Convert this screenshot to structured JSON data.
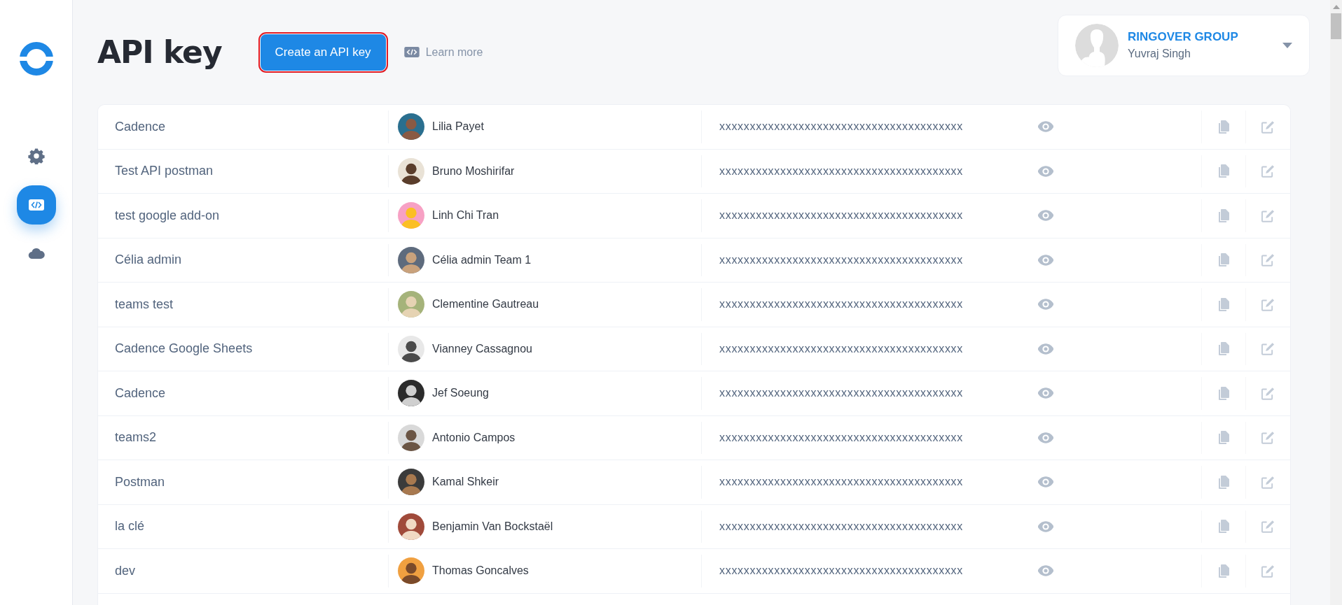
{
  "sidebar": {
    "items": [
      {
        "kind": "settings",
        "selected": false
      },
      {
        "kind": "code",
        "selected": true
      },
      {
        "kind": "cloud",
        "selected": false
      }
    ]
  },
  "header": {
    "title": "API key",
    "create_button": {
      "label": "Create an API key",
      "outlined": true
    },
    "learn_more": "Learn more"
  },
  "account": {
    "company": "RINGOVER GROUP",
    "user": "Yuvraj Singh"
  },
  "table": {
    "rows": [
      {
        "name": "Cadence",
        "owner": "Lilia Payet",
        "key": "xxxxxxxxxxxxxxxxxxxxxxxxxxxxxxxxxxxxxxxx"
      },
      {
        "name": "Test API postman",
        "owner": "Bruno Moshirifar",
        "key": "xxxxxxxxxxxxxxxxxxxxxxxxxxxxxxxxxxxxxxxx"
      },
      {
        "name": "test google add-on",
        "owner": "Linh Chi Tran",
        "key": "xxxxxxxxxxxxxxxxxxxxxxxxxxxxxxxxxxxxxxxx"
      },
      {
        "name": "Célia admin",
        "owner": "Célia admin Team 1",
        "key": "xxxxxxxxxxxxxxxxxxxxxxxxxxxxxxxxxxxxxxxx"
      },
      {
        "name": "teams test",
        "owner": "Clementine Gautreau",
        "key": "xxxxxxxxxxxxxxxxxxxxxxxxxxxxxxxxxxxxxxxx"
      },
      {
        "name": "Cadence Google Sheets",
        "owner": "Vianney Cassagnou",
        "key": "xxxxxxxxxxxxxxxxxxxxxxxxxxxxxxxxxxxxxxxx"
      },
      {
        "name": "Cadence",
        "owner": "Jef Soeung",
        "key": "xxxxxxxxxxxxxxxxxxxxxxxxxxxxxxxxxxxxxxxx"
      },
      {
        "name": "teams2",
        "owner": "Antonio Campos",
        "key": "xxxxxxxxxxxxxxxxxxxxxxxxxxxxxxxxxxxxxxxx"
      },
      {
        "name": "Postman",
        "owner": "Kamal Shkeir",
        "key": "xxxxxxxxxxxxxxxxxxxxxxxxxxxxxxxxxxxxxxxx"
      },
      {
        "name": "la clé",
        "owner": "Benjamin Van Bockstaël",
        "key": "xxxxxxxxxxxxxxxxxxxxxxxxxxxxxxxxxxxxxxxx"
      },
      {
        "name": "dev",
        "owner": "Thomas Goncalves",
        "key": "xxxxxxxxxxxxxxxxxxxxxxxxxxxxxxxxxxxxxxxx"
      }
    ]
  }
}
